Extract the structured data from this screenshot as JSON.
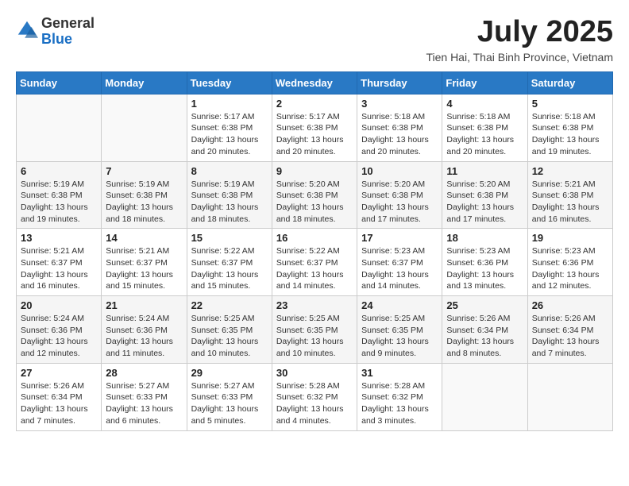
{
  "header": {
    "logo": {
      "general": "General",
      "blue": "Blue"
    },
    "title": "July 2025",
    "location": "Tien Hai, Thai Binh Province, Vietnam"
  },
  "weekdays": [
    "Sunday",
    "Monday",
    "Tuesday",
    "Wednesday",
    "Thursday",
    "Friday",
    "Saturday"
  ],
  "weeks": [
    [
      {
        "day": "",
        "info": ""
      },
      {
        "day": "",
        "info": ""
      },
      {
        "day": "1",
        "info": "Sunrise: 5:17 AM\nSunset: 6:38 PM\nDaylight: 13 hours and 20 minutes."
      },
      {
        "day": "2",
        "info": "Sunrise: 5:17 AM\nSunset: 6:38 PM\nDaylight: 13 hours and 20 minutes."
      },
      {
        "day": "3",
        "info": "Sunrise: 5:18 AM\nSunset: 6:38 PM\nDaylight: 13 hours and 20 minutes."
      },
      {
        "day": "4",
        "info": "Sunrise: 5:18 AM\nSunset: 6:38 PM\nDaylight: 13 hours and 20 minutes."
      },
      {
        "day": "5",
        "info": "Sunrise: 5:18 AM\nSunset: 6:38 PM\nDaylight: 13 hours and 19 minutes."
      }
    ],
    [
      {
        "day": "6",
        "info": "Sunrise: 5:19 AM\nSunset: 6:38 PM\nDaylight: 13 hours and 19 minutes."
      },
      {
        "day": "7",
        "info": "Sunrise: 5:19 AM\nSunset: 6:38 PM\nDaylight: 13 hours and 18 minutes."
      },
      {
        "day": "8",
        "info": "Sunrise: 5:19 AM\nSunset: 6:38 PM\nDaylight: 13 hours and 18 minutes."
      },
      {
        "day": "9",
        "info": "Sunrise: 5:20 AM\nSunset: 6:38 PM\nDaylight: 13 hours and 18 minutes."
      },
      {
        "day": "10",
        "info": "Sunrise: 5:20 AM\nSunset: 6:38 PM\nDaylight: 13 hours and 17 minutes."
      },
      {
        "day": "11",
        "info": "Sunrise: 5:20 AM\nSunset: 6:38 PM\nDaylight: 13 hours and 17 minutes."
      },
      {
        "day": "12",
        "info": "Sunrise: 5:21 AM\nSunset: 6:38 PM\nDaylight: 13 hours and 16 minutes."
      }
    ],
    [
      {
        "day": "13",
        "info": "Sunrise: 5:21 AM\nSunset: 6:37 PM\nDaylight: 13 hours and 16 minutes."
      },
      {
        "day": "14",
        "info": "Sunrise: 5:21 AM\nSunset: 6:37 PM\nDaylight: 13 hours and 15 minutes."
      },
      {
        "day": "15",
        "info": "Sunrise: 5:22 AM\nSunset: 6:37 PM\nDaylight: 13 hours and 15 minutes."
      },
      {
        "day": "16",
        "info": "Sunrise: 5:22 AM\nSunset: 6:37 PM\nDaylight: 13 hours and 14 minutes."
      },
      {
        "day": "17",
        "info": "Sunrise: 5:23 AM\nSunset: 6:37 PM\nDaylight: 13 hours and 14 minutes."
      },
      {
        "day": "18",
        "info": "Sunrise: 5:23 AM\nSunset: 6:36 PM\nDaylight: 13 hours and 13 minutes."
      },
      {
        "day": "19",
        "info": "Sunrise: 5:23 AM\nSunset: 6:36 PM\nDaylight: 13 hours and 12 minutes."
      }
    ],
    [
      {
        "day": "20",
        "info": "Sunrise: 5:24 AM\nSunset: 6:36 PM\nDaylight: 13 hours and 12 minutes."
      },
      {
        "day": "21",
        "info": "Sunrise: 5:24 AM\nSunset: 6:36 PM\nDaylight: 13 hours and 11 minutes."
      },
      {
        "day": "22",
        "info": "Sunrise: 5:25 AM\nSunset: 6:35 PM\nDaylight: 13 hours and 10 minutes."
      },
      {
        "day": "23",
        "info": "Sunrise: 5:25 AM\nSunset: 6:35 PM\nDaylight: 13 hours and 10 minutes."
      },
      {
        "day": "24",
        "info": "Sunrise: 5:25 AM\nSunset: 6:35 PM\nDaylight: 13 hours and 9 minutes."
      },
      {
        "day": "25",
        "info": "Sunrise: 5:26 AM\nSunset: 6:34 PM\nDaylight: 13 hours and 8 minutes."
      },
      {
        "day": "26",
        "info": "Sunrise: 5:26 AM\nSunset: 6:34 PM\nDaylight: 13 hours and 7 minutes."
      }
    ],
    [
      {
        "day": "27",
        "info": "Sunrise: 5:26 AM\nSunset: 6:34 PM\nDaylight: 13 hours and 7 minutes."
      },
      {
        "day": "28",
        "info": "Sunrise: 5:27 AM\nSunset: 6:33 PM\nDaylight: 13 hours and 6 minutes."
      },
      {
        "day": "29",
        "info": "Sunrise: 5:27 AM\nSunset: 6:33 PM\nDaylight: 13 hours and 5 minutes."
      },
      {
        "day": "30",
        "info": "Sunrise: 5:28 AM\nSunset: 6:32 PM\nDaylight: 13 hours and 4 minutes."
      },
      {
        "day": "31",
        "info": "Sunrise: 5:28 AM\nSunset: 6:32 PM\nDaylight: 13 hours and 3 minutes."
      },
      {
        "day": "",
        "info": ""
      },
      {
        "day": "",
        "info": ""
      }
    ]
  ]
}
